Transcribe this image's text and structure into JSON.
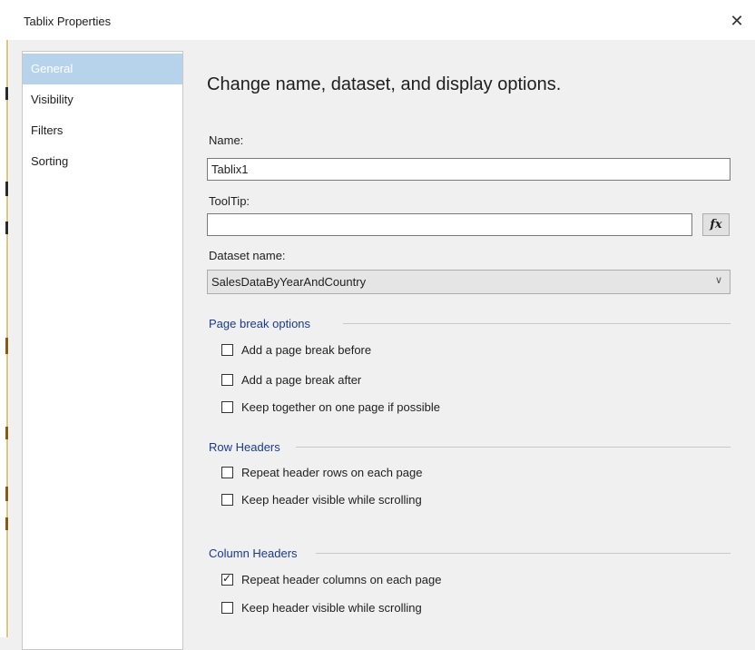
{
  "window": {
    "title": "Tablix Properties",
    "close_glyph": "✕"
  },
  "sidebar": {
    "items": [
      {
        "label": "General",
        "active": true
      },
      {
        "label": "Visibility"
      },
      {
        "label": "Filters"
      },
      {
        "label": "Sorting"
      }
    ]
  },
  "general": {
    "heading": "Change name, dataset, and display options.",
    "name_label": "Name:",
    "name_value": "Tablix1",
    "tooltip_label": "ToolTip:",
    "tooltip_value": "",
    "fx_label": "fx",
    "dataset_label": "Dataset name:",
    "dataset_value": "SalesDataByYearAndCountry"
  },
  "groups": {
    "page_break": {
      "title": "Page break options",
      "options": [
        {
          "label": "Add a page break before",
          "checked": false
        },
        {
          "label": "Add a page break after",
          "checked": false
        },
        {
          "label": "Keep together on one page if possible",
          "checked": false
        }
      ]
    },
    "row_headers": {
      "title": "Row Headers",
      "options": [
        {
          "label": "Repeat header rows on each page",
          "checked": false
        },
        {
          "label": "Keep header visible while scrolling",
          "checked": false
        }
      ]
    },
    "column_headers": {
      "title": "Column Headers",
      "options": [
        {
          "label": "Repeat header columns on each page",
          "checked": true
        },
        {
          "label": "Keep header visible while scrolling",
          "checked": false
        }
      ]
    }
  },
  "colors": {
    "accent": "#1a3a8a",
    "selected_nav": "#b7d3ec"
  }
}
